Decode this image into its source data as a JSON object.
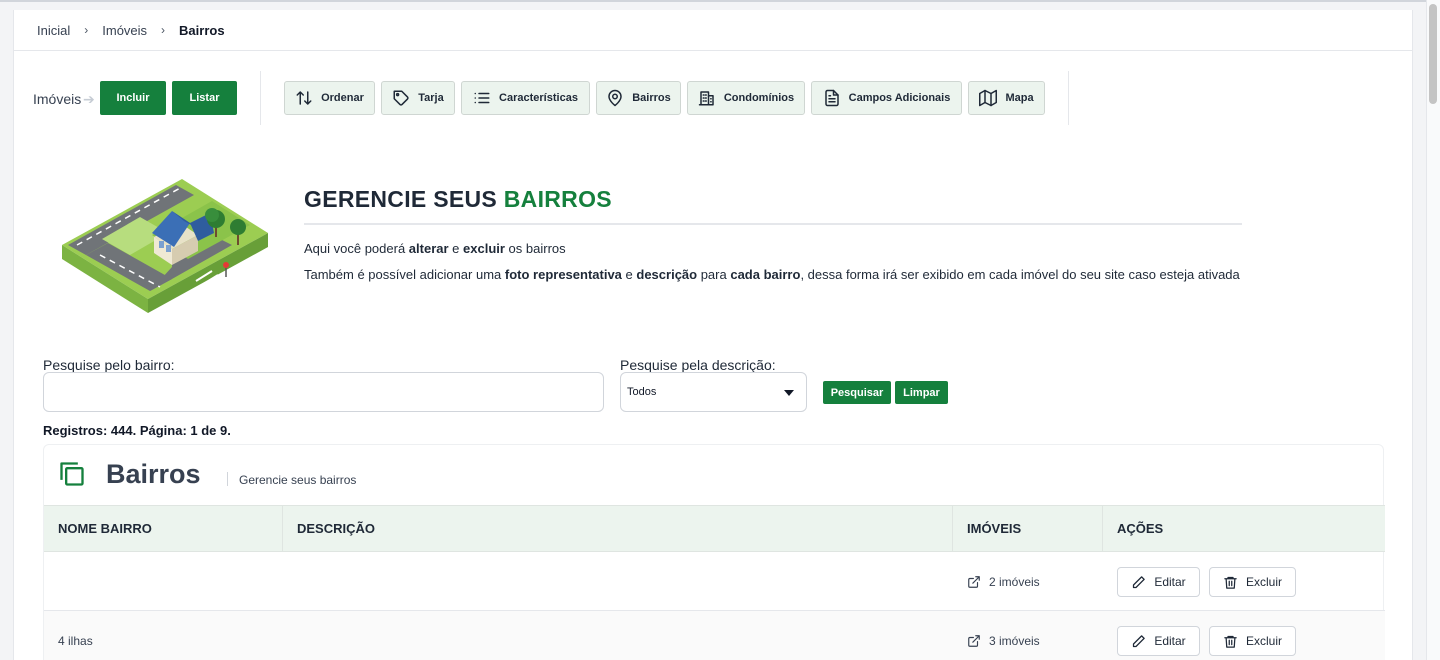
{
  "breadcrumb": {
    "items": [
      "Inicial",
      "Imóveis"
    ],
    "current": "Bairros",
    "separator": "›"
  },
  "toolbar": {
    "section_label": "Imóveis",
    "arrow": "➔",
    "buttons": {
      "incluir": "Incluir",
      "listar": "Listar"
    },
    "tools": [
      {
        "label": "Ordenar",
        "icon": "sort-arrows-icon"
      },
      {
        "label": "Tarja",
        "icon": "tag-icon"
      },
      {
        "label": "Características",
        "icon": "list-icon"
      },
      {
        "label": "Bairros",
        "icon": "map-pin-icon"
      },
      {
        "label": "Condomínios",
        "icon": "building-icon"
      },
      {
        "label": "Campos Adicionais",
        "icon": "document-icon"
      },
      {
        "label": "Mapa",
        "icon": "map-icon"
      }
    ]
  },
  "hero": {
    "title_prefix": "GERENCIE SEUS",
    "title_accent": "BAIRROS",
    "line1": {
      "t1": "Aqui você poderá ",
      "b1": "alterar",
      "t2": " e ",
      "b2": "excluir",
      "t3": " os bairros"
    },
    "line2": {
      "t1": "Também é possível adicionar uma ",
      "b1": "foto representativa",
      "t2": " e ",
      "b2": "descrição",
      "t3": " para ",
      "b3": "cada bairro",
      "t4": ", dessa forma irá ser exibido em cada imóvel do seu site caso esteja ativada"
    }
  },
  "search": {
    "bairro_label": "Pesquise pelo bairro:",
    "bairro_value": "",
    "descricao_label": "Pesquise pela descrição:",
    "descricao_selected": "Todos",
    "search_button": "Pesquisar",
    "clear_button": "Limpar"
  },
  "records": "Registros: 444. Página: 1 de 9.",
  "card": {
    "title": "Bairros",
    "subtitle": "Gerencie seus bairros",
    "columns": [
      "NOME BAIRRO",
      "DESCRIÇÃO",
      "IMÓVEIS",
      "AÇÕES"
    ],
    "rows": [
      {
        "nome": "",
        "descricao": "",
        "imoveis": "2 imóveis"
      },
      {
        "nome": "4 ilhas",
        "descricao": "",
        "imoveis": "3 imóveis"
      }
    ],
    "actions": {
      "edit": "Editar",
      "delete": "Excluir"
    }
  },
  "colors": {
    "primary": "#15803d",
    "accent_text": "#15803d",
    "header_bg": "#ecf4ee"
  }
}
